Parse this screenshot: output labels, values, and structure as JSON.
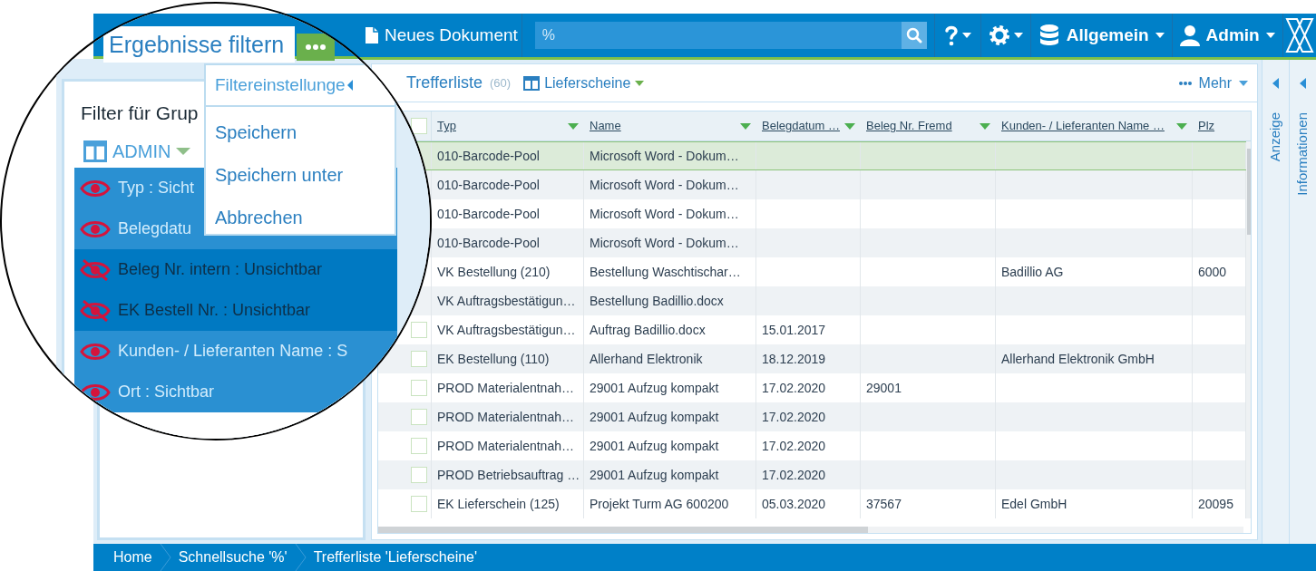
{
  "lens": {
    "tab": {
      "label": "Ergebnisse filtern",
      "selected": true
    },
    "menu": {
      "title": "Filtereinstellunge",
      "items": [
        "Speichern",
        "Speichern unter",
        "Abbrechen"
      ]
    },
    "filter_panel": {
      "title": "Filter für Grup",
      "layout": "ADMIN",
      "fields": [
        {
          "label": "Typ : Sicht",
          "visible": true
        },
        {
          "label": "Belegdatu",
          "visible": true
        },
        {
          "label": "Beleg Nr. intern : Unsichtbar",
          "visible": false
        },
        {
          "label": "EK Bestell Nr. : Unsichtbar",
          "visible": false
        },
        {
          "label": "Kunden- / Lieferanten Name : S",
          "visible": true
        },
        {
          "label": "Ort : Sichtbar",
          "visible": true
        }
      ]
    }
  },
  "toolbar": {
    "new_document": "Neues Dokument",
    "search": {
      "value": "%"
    },
    "workspace": "Allgemein",
    "user": "Admin"
  },
  "results": {
    "title": "Trefferliste",
    "count": "(60)",
    "view": "Lieferscheine",
    "more": "Mehr"
  },
  "table": {
    "select_all": {
      "checked": false
    },
    "columns": [
      {
        "label": "Typ",
        "filter": true
      },
      {
        "label": "Name",
        "filter": true
      },
      {
        "label": "Belegdatum …",
        "filter": true
      },
      {
        "label": "Beleg Nr. Fremd",
        "filter": true
      },
      {
        "label": "Kunden- / Lieferanten Name …",
        "filter": true
      },
      {
        "label": "Plz",
        "filter": false
      }
    ],
    "rows": [
      {
        "selected": true,
        "typ": "010-Barcode-Pool",
        "name": "Microsoft Word - Dokum…"
      },
      {
        "selected": false,
        "typ": "010-Barcode-Pool",
        "name": "Microsoft Word - Dokum…"
      },
      {
        "selected": false,
        "typ": "010-Barcode-Pool",
        "name": "Microsoft Word - Dokum…"
      },
      {
        "selected": false,
        "typ": "010-Barcode-Pool",
        "name": "Microsoft Word - Dokum…"
      },
      {
        "selected": false,
        "typ": "VK Bestellung (210)",
        "name": "Bestellung Waschtischar…",
        "kunde": "Badillio AG",
        "plz": "6000"
      },
      {
        "selected": false,
        "typ": "VK Auftragsbestätigun…",
        "name": "Bestellung Badillio.docx"
      },
      {
        "selected": false,
        "checked": false,
        "typ": "VK Auftragsbestätigun…",
        "name": "Auftrag Badillio.docx",
        "belegdatum": "15.01.2017"
      },
      {
        "selected": false,
        "checked": false,
        "typ": "EK Bestellung (110)",
        "name": "Allerhand Elektronik",
        "belegdatum": "18.12.2019",
        "kunde": "Allerhand Elektronik GmbH"
      },
      {
        "selected": false,
        "checked": false,
        "typ": "PROD Materialentnah…",
        "name": "29001 Aufzug kompakt",
        "belegdatum": "17.02.2020",
        "fremd": "29001"
      },
      {
        "selected": false,
        "checked": false,
        "typ": "PROD Materialentnah…",
        "name": "29001 Aufzug kompakt",
        "belegdatum": "17.02.2020"
      },
      {
        "selected": false,
        "checked": false,
        "typ": "PROD Materialentnah…",
        "name": "29001 Aufzug kompakt",
        "belegdatum": "17.02.2020"
      },
      {
        "selected": false,
        "checked": false,
        "typ": "PROD Betriebsauftrag …",
        "name": "29001 Aufzug kompakt",
        "belegdatum": "17.02.2020"
      },
      {
        "selected": false,
        "checked": false,
        "typ": "EK Lieferschein (125)",
        "name": "Projekt Turm AG 600200",
        "belegdatum": "05.03.2020",
        "fremd": "37567",
        "kunde": "Edel GmbH",
        "plz": "20095"
      }
    ]
  },
  "side_tabs": [
    "Anzeige",
    "Informationen"
  ],
  "breadcrumb": [
    "Home",
    "Schnellsuche '%'",
    "Trefferliste 'Lieferscheine'"
  ]
}
